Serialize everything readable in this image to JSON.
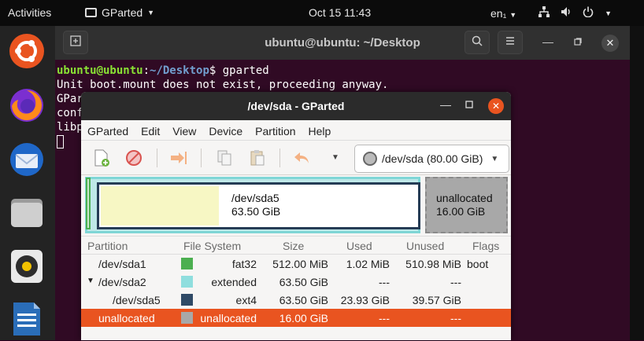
{
  "topbar": {
    "activities": "Activities",
    "app_name": "GParted",
    "clock": "Oct 15  11:43",
    "lang": "en₁"
  },
  "terminal": {
    "title": "ubuntu@ubuntu: ~/Desktop",
    "user_host": "ubuntu@ubuntu",
    "colon": ":",
    "path": "~/Desktop",
    "prompt_tail": "$ gparted",
    "lines": [
      "Unit boot.mount does not exist, proceeding anyway.",
      "GPar",
      "conf",
      "libp"
    ]
  },
  "gparted": {
    "title": "/dev/sda - GParted",
    "menu": [
      "GParted",
      "Edit",
      "View",
      "Device",
      "Partition",
      "Help"
    ],
    "device": "/dev/sda (80.00 GiB)",
    "map": {
      "sda5_name": "/dev/sda5",
      "sda5_size": "63.50 GiB",
      "unalloc_name": "unallocated",
      "unalloc_size": "16.00 GiB"
    },
    "columns": {
      "partition": "Partition",
      "filesystem": "File System",
      "size": "Size",
      "used": "Used",
      "unused": "Unused",
      "flags": "Flags"
    },
    "rows": [
      {
        "partition": "/dev/sda1",
        "fs": "fat32",
        "size": "512.00 MiB",
        "used": "1.02 MiB",
        "unused": "510.98 MiB",
        "flags": "boot",
        "color": "#4caf50"
      },
      {
        "partition": "/dev/sda2",
        "fs": "extended",
        "size": "63.50 GiB",
        "used": "---",
        "unused": "---",
        "flags": "",
        "color": "#8fdede"
      },
      {
        "partition": "/dev/sda5",
        "fs": "ext4",
        "size": "63.50 GiB",
        "used": "23.93 GiB",
        "unused": "39.57 GiB",
        "flags": "",
        "color": "#2f4a66"
      },
      {
        "partition": "unallocated",
        "fs": "unallocated",
        "size": "16.00 GiB",
        "used": "---",
        "unused": "---",
        "flags": "",
        "color": "#a8a8a8"
      }
    ],
    "accent": "#e95420"
  }
}
